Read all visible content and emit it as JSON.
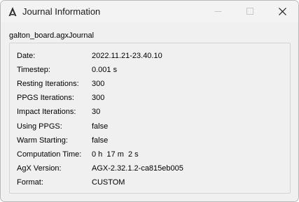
{
  "window": {
    "title": "Journal Information"
  },
  "icons": {
    "app": "agx-logo-icon",
    "minimize": "minimize-icon",
    "maximize": "maximize-icon",
    "close": "close-icon"
  },
  "file": {
    "name": "galton_board.agxJournal"
  },
  "info_rows": [
    {
      "label": "Date:",
      "value": "2022.11.21-23.40.10"
    },
    {
      "label": "Timestep:",
      "value": "0.001 s"
    },
    {
      "label": "Resting Iterations:",
      "value": "300"
    },
    {
      "label": "PPGS Iterations:",
      "value": "300"
    },
    {
      "label": "Impact Iterations:",
      "value": "30"
    },
    {
      "label": "Using PPGS:",
      "value": "false"
    },
    {
      "label": "Warm Starting:",
      "value": "false"
    },
    {
      "label": "Computation Time:",
      "value": "0 h  17 m  2 s"
    },
    {
      "label": "AgX Version:",
      "value": "AGX-2.32.1.2-ca815eb005"
    },
    {
      "label": "Format:",
      "value": "CUSTOM"
    }
  ]
}
